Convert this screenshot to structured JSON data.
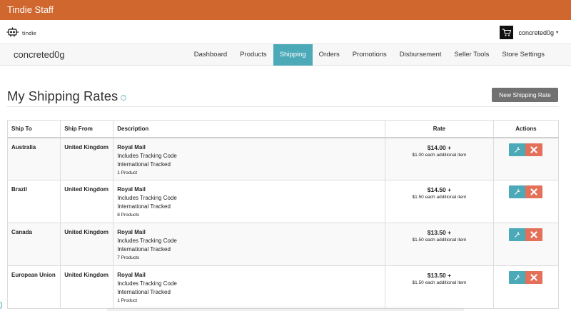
{
  "staff_bar": {
    "label": "Tindie Staff"
  },
  "logo": {
    "text": "tindie"
  },
  "user": {
    "name": "concreted0g",
    "caret": "▾"
  },
  "store": {
    "name": "concreted0g",
    "tabs": [
      {
        "label": "Dashboard"
      },
      {
        "label": "Products"
      },
      {
        "label": "Shipping"
      },
      {
        "label": "Orders"
      },
      {
        "label": "Promotions"
      },
      {
        "label": "Disbursement"
      },
      {
        "label": "Seller Tools"
      },
      {
        "label": "Store Settings"
      }
    ],
    "active_tab": "Shipping"
  },
  "page": {
    "title": "My Shipping Rates",
    "help_glyph": "?",
    "new_button": "New Shipping Rate"
  },
  "table": {
    "headers": {
      "ship_to": "Ship To",
      "ship_from": "Ship From",
      "description": "Description",
      "rate": "Rate",
      "actions": "Actions"
    },
    "rows": [
      {
        "ship_to": "Australia",
        "ship_from": "United Kingdom",
        "carrier": "Royal Mail",
        "line1": "Includes Tracking Code",
        "line2": "International Tracked",
        "products": "1 Product",
        "rate": "$14.00 +",
        "additional": "$1.00 each additional item"
      },
      {
        "ship_to": "Brazil",
        "ship_from": "United Kingdom",
        "carrier": "Royal Mail",
        "line1": "Includes Tracking Code",
        "line2": "International Tracked",
        "products": "8 Products",
        "rate": "$14.50 +",
        "additional": "$1.50 each additional item"
      },
      {
        "ship_to": "Canada",
        "ship_from": "United Kingdom",
        "carrier": "Royal Mail",
        "line1": "Includes Tracking Code",
        "line2": "International Tracked",
        "products": "7 Products",
        "rate": "$13.50 +",
        "additional": "$1.50 each additional item"
      },
      {
        "ship_to": "European Union",
        "ship_from": "United Kingdom",
        "carrier": "Royal Mail",
        "line1": "Includes Tracking Code",
        "line2": "International Tracked",
        "products": "1 Product",
        "rate": "$13.50 +",
        "additional": "$1.50 each additional item"
      }
    ]
  },
  "colors": {
    "staff_bar": "#d0672e",
    "accent": "#4ca9b8",
    "delete": "#e4705a",
    "button_gray": "#717171"
  },
  "icons": {
    "edit": "wrench-icon",
    "delete": "close-icon",
    "help": "help-icon",
    "logo": "tindie-robot-icon",
    "avatar": "cart-icon"
  }
}
